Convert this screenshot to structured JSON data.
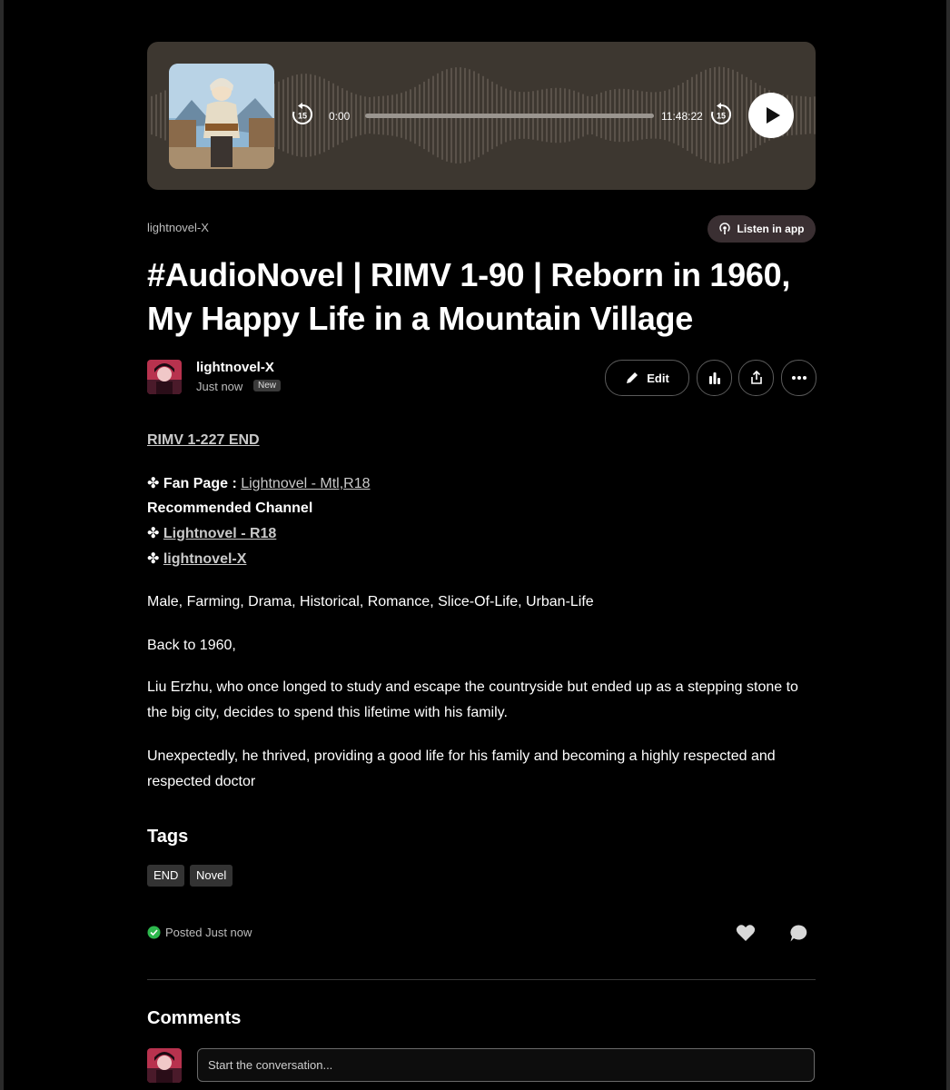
{
  "player": {
    "current_time": "0:00",
    "duration": "11:48:22",
    "skip_back_label": "15",
    "skip_forward_label": "15",
    "progress": 0,
    "background": "#3d3730"
  },
  "header": {
    "creator": "lightnovel-X",
    "listen_in_app": "Listen in app"
  },
  "post": {
    "title": "#AudioNovel | RIMV 1-90 | Reborn in 1960, My Happy Life in a Mountain Village",
    "author_name": "lightnovel-X",
    "posted_time": "Just now",
    "new_badge": "New",
    "edit_label": "Edit"
  },
  "content": {
    "series_link": "RIMV 1-227 END",
    "fan_page_bullet": "✤",
    "fan_page_label": "Fan Page :",
    "fan_page_link": "Lightnovel - Mtl,R18",
    "recommended_heading": "Recommended Channel",
    "channel_1": "Lightnovel - R18",
    "channel_2": "lightnovel-X",
    "genres": "Male, Farming, Drama, Historical, Romance, Slice-Of-Life, Urban-Life",
    "para_1": "Back to 1960,",
    "para_2": "Liu Erzhu, who once longed to study and escape the countryside but ended up as a stepping stone to the big city, decides to spend this lifetime with his family.",
    "para_3": "Unexpectedly, he thrived, providing a good life for his family and becoming a highly respected and respected doctor"
  },
  "tags": {
    "heading": "Tags",
    "items": [
      "END",
      "Novel"
    ]
  },
  "footer": {
    "posted_label": "Posted Just now",
    "check_color": "#2db84d"
  },
  "comments": {
    "heading": "Comments",
    "placeholder": "Start the conversation..."
  },
  "icons": [
    "skip-back-15-icon",
    "skip-forward-15-icon",
    "play-icon",
    "podcast-icon",
    "pencil-icon",
    "stats-icon",
    "share-icon",
    "more-icon",
    "heart-icon",
    "comment-icon",
    "check-circle-icon"
  ]
}
